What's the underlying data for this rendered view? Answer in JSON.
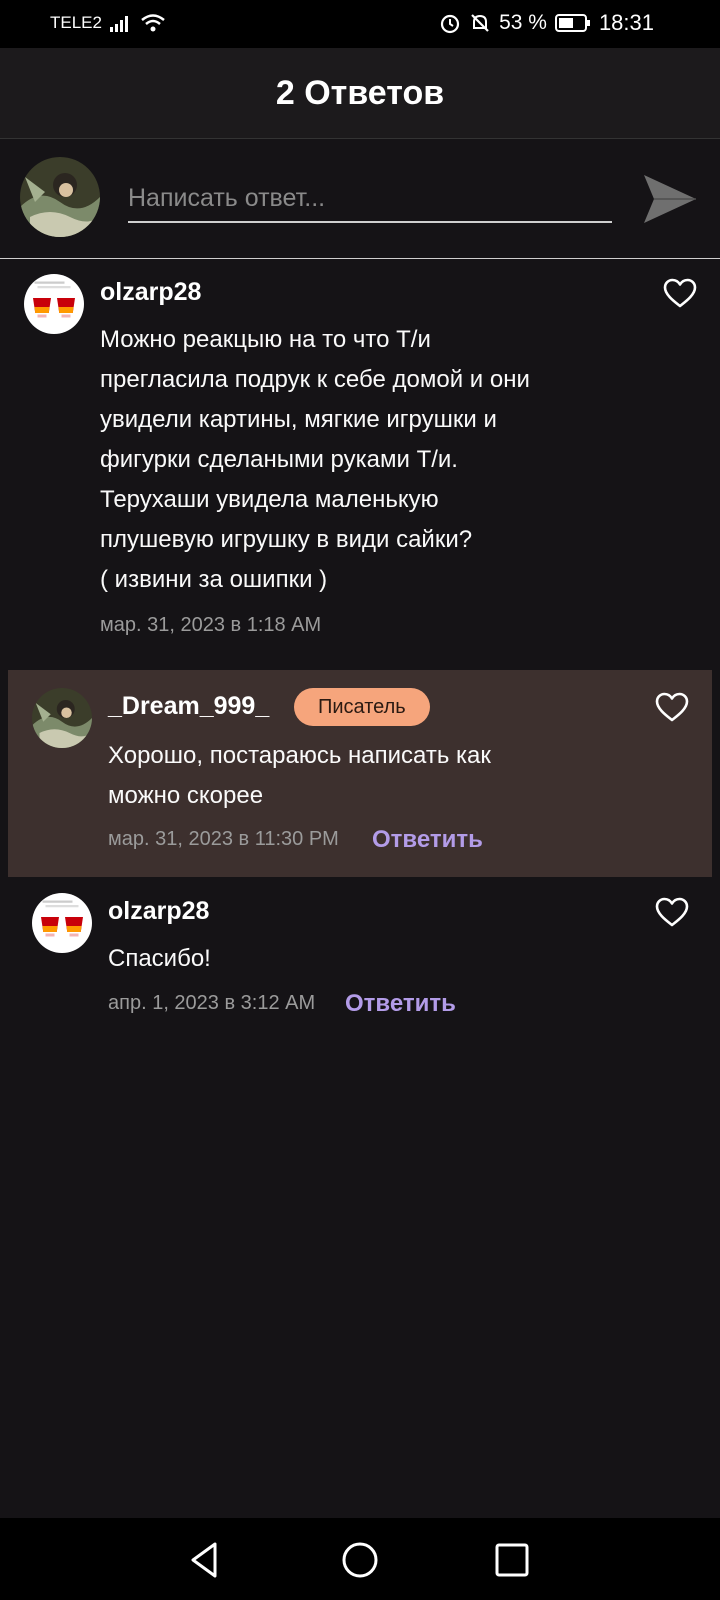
{
  "status_bar": {
    "carrier": "TELE2",
    "battery": "53 %",
    "time": "18:31"
  },
  "header": {
    "title": "2 Ответов"
  },
  "composer": {
    "placeholder": "Написать ответ..."
  },
  "comments": [
    {
      "username": "olzarp28",
      "text_lines": [
        "Можно реакцыю на то что Т/и",
        "прегласила подрук к себе домой и они",
        "увидели картины, мягкие игрушки и",
        "фигурки сделаными руками Т/и.",
        "Терухаши увидела маленькую",
        "плушевую игрушку в види сайки?",
        "( извини за ошипки )"
      ],
      "timestamp": "мар. 31, 2023 в 1:18 AM"
    },
    {
      "username": "_Dream_999_",
      "badge": "Писатель",
      "text_lines": [
        "Хорошо, постараюсь написать как",
        "можно скорее"
      ],
      "timestamp": "мар. 31, 2023 в 11:30 PM",
      "reply_label": "Ответить"
    },
    {
      "username": "olzarp28",
      "text_lines": [
        "Спасибо!"
      ],
      "timestamp": "апр. 1, 2023 в 3:12 AM",
      "reply_label": "Ответить"
    }
  ],
  "colors": {
    "background": "#151316",
    "highlight": "#3d302e",
    "badge": "#f6a57c",
    "reply": "#b39ce8"
  }
}
